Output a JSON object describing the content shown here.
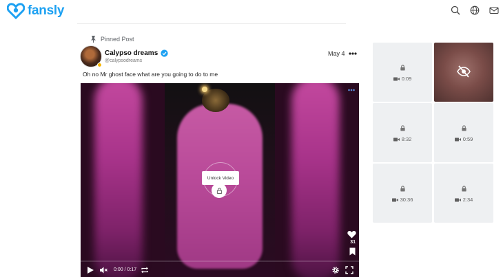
{
  "brand": {
    "name": "fansly",
    "color": "#1da1f2"
  },
  "header_icons": [
    "search-icon",
    "globe-icon",
    "mail-icon"
  ],
  "pinned": {
    "label": "Pinned Post"
  },
  "post": {
    "display_name": "Calypso dreams",
    "handle": "@calypsodreams",
    "date": "May 4",
    "caption": "Oh no Mr ghost face what are you going to do to me",
    "media": {
      "unlock_label": "Unlock Video",
      "likes": "31",
      "time_display": "0:00 / 0:17"
    }
  },
  "sidebar_tiles": [
    {
      "type": "video",
      "locked": true,
      "duration": "0:09"
    },
    {
      "type": "photo",
      "hidden": true
    },
    {
      "type": "video",
      "locked": true,
      "duration": "8:32"
    },
    {
      "type": "video",
      "locked": true,
      "duration": "0:59"
    },
    {
      "type": "video",
      "locked": true,
      "duration": "30:36"
    },
    {
      "type": "video",
      "locked": true,
      "duration": "2:34"
    }
  ]
}
